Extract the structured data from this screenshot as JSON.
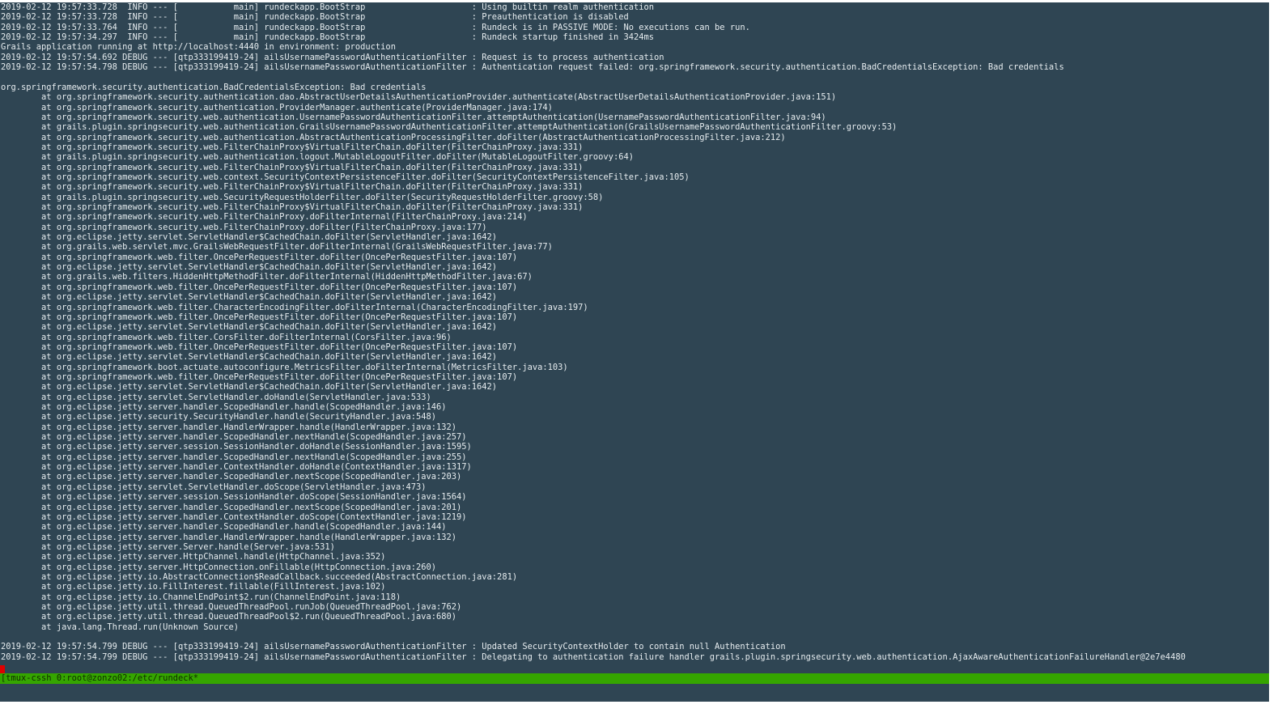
{
  "window": {
    "title": "[tmux-cssh 0:root@zonzo02:/etc/rundeck*"
  },
  "log_lines": [
    "2019-02-12 19:57:33.728  INFO --- [           main] rundeckapp.BootStrap                     : Using builtin realm authentication",
    "2019-02-12 19:57:33.728  INFO --- [           main] rundeckapp.BootStrap                     : Preauthentication is disabled",
    "2019-02-12 19:57:33.764  INFO --- [           main] rundeckapp.BootStrap                     : Rundeck is in PASSIVE MODE: No executions can be run.",
    "2019-02-12 19:57:34.297  INFO --- [           main] rundeckapp.BootStrap                     : Rundeck startup finished in 3424ms",
    "Grails application running at http://localhost:4440 in environment: production",
    "2019-02-12 19:57:54.692 DEBUG --- [qtp333199419-24] ailsUsernamePasswordAuthenticationFilter : Request is to process authentication",
    "2019-02-12 19:57:54.798 DEBUG --- [qtp333199419-24] ailsUsernamePasswordAuthenticationFilter : Authentication request failed: org.springframework.security.authentication.BadCredentialsException: Bad credentials",
    "",
    "org.springframework.security.authentication.BadCredentialsException: Bad credentials",
    "        at org.springframework.security.authentication.dao.AbstractUserDetailsAuthenticationProvider.authenticate(AbstractUserDetailsAuthenticationProvider.java:151)",
    "        at org.springframework.security.authentication.ProviderManager.authenticate(ProviderManager.java:174)",
    "        at org.springframework.security.web.authentication.UsernamePasswordAuthenticationFilter.attemptAuthentication(UsernamePasswordAuthenticationFilter.java:94)",
    "        at grails.plugin.springsecurity.web.authentication.GrailsUsernamePasswordAuthenticationFilter.attemptAuthentication(GrailsUsernamePasswordAuthenticationFilter.groovy:53)",
    "        at org.springframework.security.web.authentication.AbstractAuthenticationProcessingFilter.doFilter(AbstractAuthenticationProcessingFilter.java:212)",
    "        at org.springframework.security.web.FilterChainProxy$VirtualFilterChain.doFilter(FilterChainProxy.java:331)",
    "        at grails.plugin.springsecurity.web.authentication.logout.MutableLogoutFilter.doFilter(MutableLogoutFilter.groovy:64)",
    "        at org.springframework.security.web.FilterChainProxy$VirtualFilterChain.doFilter(FilterChainProxy.java:331)",
    "        at org.springframework.security.web.context.SecurityContextPersistenceFilter.doFilter(SecurityContextPersistenceFilter.java:105)",
    "        at org.springframework.security.web.FilterChainProxy$VirtualFilterChain.doFilter(FilterChainProxy.java:331)",
    "        at grails.plugin.springsecurity.web.SecurityRequestHolderFilter.doFilter(SecurityRequestHolderFilter.groovy:58)",
    "        at org.springframework.security.web.FilterChainProxy$VirtualFilterChain.doFilter(FilterChainProxy.java:331)",
    "        at org.springframework.security.web.FilterChainProxy.doFilterInternal(FilterChainProxy.java:214)",
    "        at org.springframework.security.web.FilterChainProxy.doFilter(FilterChainProxy.java:177)",
    "        at org.eclipse.jetty.servlet.ServletHandler$CachedChain.doFilter(ServletHandler.java:1642)",
    "        at org.grails.web.servlet.mvc.GrailsWebRequestFilter.doFilterInternal(GrailsWebRequestFilter.java:77)",
    "        at org.springframework.web.filter.OncePerRequestFilter.doFilter(OncePerRequestFilter.java:107)",
    "        at org.eclipse.jetty.servlet.ServletHandler$CachedChain.doFilter(ServletHandler.java:1642)",
    "        at org.grails.web.filters.HiddenHttpMethodFilter.doFilterInternal(HiddenHttpMethodFilter.java:67)",
    "        at org.springframework.web.filter.OncePerRequestFilter.doFilter(OncePerRequestFilter.java:107)",
    "        at org.eclipse.jetty.servlet.ServletHandler$CachedChain.doFilter(ServletHandler.java:1642)",
    "        at org.springframework.web.filter.CharacterEncodingFilter.doFilterInternal(CharacterEncodingFilter.java:197)",
    "        at org.springframework.web.filter.OncePerRequestFilter.doFilter(OncePerRequestFilter.java:107)",
    "        at org.eclipse.jetty.servlet.ServletHandler$CachedChain.doFilter(ServletHandler.java:1642)",
    "        at org.springframework.web.filter.CorsFilter.doFilterInternal(CorsFilter.java:96)",
    "        at org.springframework.web.filter.OncePerRequestFilter.doFilter(OncePerRequestFilter.java:107)",
    "        at org.eclipse.jetty.servlet.ServletHandler$CachedChain.doFilter(ServletHandler.java:1642)",
    "        at org.springframework.boot.actuate.autoconfigure.MetricsFilter.doFilterInternal(MetricsFilter.java:103)",
    "        at org.springframework.web.filter.OncePerRequestFilter.doFilter(OncePerRequestFilter.java:107)",
    "        at org.eclipse.jetty.servlet.ServletHandler$CachedChain.doFilter(ServletHandler.java:1642)",
    "        at org.eclipse.jetty.servlet.ServletHandler.doHandle(ServletHandler.java:533)",
    "        at org.eclipse.jetty.server.handler.ScopedHandler.handle(ScopedHandler.java:146)",
    "        at org.eclipse.jetty.security.SecurityHandler.handle(SecurityHandler.java:548)",
    "        at org.eclipse.jetty.server.handler.HandlerWrapper.handle(HandlerWrapper.java:132)",
    "        at org.eclipse.jetty.server.handler.ScopedHandler.nextHandle(ScopedHandler.java:257)",
    "        at org.eclipse.jetty.server.session.SessionHandler.doHandle(SessionHandler.java:1595)",
    "        at org.eclipse.jetty.server.handler.ScopedHandler.nextHandle(ScopedHandler.java:255)",
    "        at org.eclipse.jetty.server.handler.ContextHandler.doHandle(ContextHandler.java:1317)",
    "        at org.eclipse.jetty.server.handler.ScopedHandler.nextScope(ScopedHandler.java:203)",
    "        at org.eclipse.jetty.servlet.ServletHandler.doScope(ServletHandler.java:473)",
    "        at org.eclipse.jetty.server.session.SessionHandler.doScope(SessionHandler.java:1564)",
    "        at org.eclipse.jetty.server.handler.ScopedHandler.nextScope(ScopedHandler.java:201)",
    "        at org.eclipse.jetty.server.handler.ContextHandler.doScope(ContextHandler.java:1219)",
    "        at org.eclipse.jetty.server.handler.ScopedHandler.handle(ScopedHandler.java:144)",
    "        at org.eclipse.jetty.server.handler.HandlerWrapper.handle(HandlerWrapper.java:132)",
    "        at org.eclipse.jetty.server.Server.handle(Server.java:531)",
    "        at org.eclipse.jetty.server.HttpChannel.handle(HttpChannel.java:352)",
    "        at org.eclipse.jetty.server.HttpConnection.onFillable(HttpConnection.java:260)",
    "        at org.eclipse.jetty.io.AbstractConnection$ReadCallback.succeeded(AbstractConnection.java:281)",
    "        at org.eclipse.jetty.io.FillInterest.fillable(FillInterest.java:102)",
    "        at org.eclipse.jetty.io.ChannelEndPoint$2.run(ChannelEndPoint.java:118)",
    "        at org.eclipse.jetty.util.thread.QueuedThreadPool.runJob(QueuedThreadPool.java:762)",
    "        at org.eclipse.jetty.util.thread.QueuedThreadPool$2.run(QueuedThreadPool.java:680)",
    "        at java.lang.Thread.run(Unknown Source)",
    "",
    "2019-02-12 19:57:54.799 DEBUG --- [qtp333199419-24] ailsUsernamePasswordAuthenticationFilter : Updated SecurityContextHolder to contain null Authentication",
    "2019-02-12 19:57:54.799 DEBUG --- [qtp333199419-24] ailsUsernamePasswordAuthenticationFilter : Delegating to authentication failure handler grails.plugin.springsecurity.web.authentication.AjaxAwareAuthenticationFailureHandler@2e7e4480"
  ],
  "colors": {
    "terminal_background": "#2f4553",
    "terminal_text": "#e6ecef",
    "status_bar": "#35a500",
    "cursor": "#e00000"
  }
}
